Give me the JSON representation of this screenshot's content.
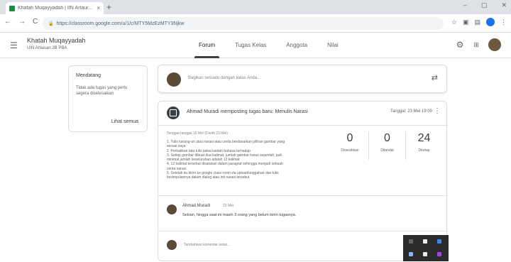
{
  "browser": {
    "tab_title": "Khatah Muqayyadah | IIN Artaur...",
    "tab_close": "×",
    "new_tab": "+",
    "win_controls": [
      "–",
      "▢",
      "✕"
    ],
    "nav_back": "←",
    "nav_forward": "→",
    "nav_reload": "C",
    "url": "https://classroom.google.com/u/1/c/MTY5MzEzMTY3Njkw",
    "lock": "🔒"
  },
  "header": {
    "menu_icon": "☰",
    "course_title": "Khatah Muqayyadah",
    "course_subtitle": "UIN Artaisan 2B PBA",
    "tabs": [
      "Forum",
      "Tugas Kelas",
      "Anggota",
      "Nilai"
    ],
    "active_tab": "Forum",
    "settings_icon": "⚙",
    "apps_icon": "⋮⋮⋮"
  },
  "upcoming": {
    "title": "Mendatang",
    "message": "Tidak ada tugas yang perlu segera diselesaikan",
    "view_all": "Lihat semua"
  },
  "share": {
    "placeholder": "Bagikan sesuatu dengan kelas Anda...",
    "repost_icon": "⇄"
  },
  "post": {
    "title": "Ahmad Muradi memposting tugas baru: Menulis Narasi",
    "date": "Tanggal: 23 Mei 19:00",
    "menu_icon": "⋮",
    "due": "Tenggat tanggal 16 Mei (Diedit 23 Mei)",
    "description_lines": [
      "1. Tulis karang-an atau narasi atau cerita berdasarkan pilihan gambar yang",
      "   sesuai saya",
      "2. Perhatikan tata tulis pakai kaidah bahasa terhadap",
      "3. Setiap gambar dibuat dua kalimat, jumlah gambar harus sejumlah, jadi",
      "   minimal jumlah keseluruhan adalah 12 kalimat",
      "4. 12 kalimat tersebut disatukan dalam paragraf sehingga menjadi sebuah",
      "   cerita narasi",
      "5. Setelah itu kirim ke google class room via upload/unggahan dan tulis",
      "   kesimpulannya dalam dialog atau inti narasi tersebut"
    ],
    "stats": [
      {
        "value": "0",
        "label": "Diserahkan"
      },
      {
        "value": "0",
        "label": "Ditandai"
      },
      {
        "value": "24",
        "label": "Ditetap"
      }
    ]
  },
  "comment": {
    "author": "Ahmad Muradi",
    "date": "23 Mei",
    "text": "Sekian, hingga saat ini masih 3 orang yang belum kirim tugasnya."
  },
  "add_comment": {
    "placeholder": "Tambahkan komentar kelas..."
  }
}
